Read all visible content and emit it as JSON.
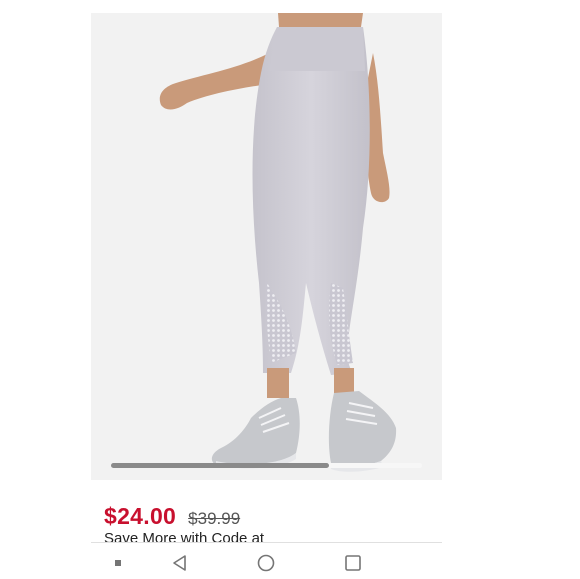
{
  "product": {
    "image_alt_icon": "leggings-photo",
    "sale_price": "$24.00",
    "original_price": "$39.99",
    "promo_text": "Save More with Code at"
  },
  "image_carousel": {
    "scroll_progress": 0.7
  },
  "colors": {
    "sale_price": "#c8102e",
    "original_price": "#555555",
    "image_background": "#f2f2f2",
    "leggings": "#cfcdd6"
  },
  "nav_bar": {
    "buttons": [
      {
        "icon": "menu-dot-icon"
      },
      {
        "icon": "back-triangle-icon"
      },
      {
        "icon": "home-circle-icon"
      },
      {
        "icon": "recents-square-icon"
      }
    ]
  }
}
